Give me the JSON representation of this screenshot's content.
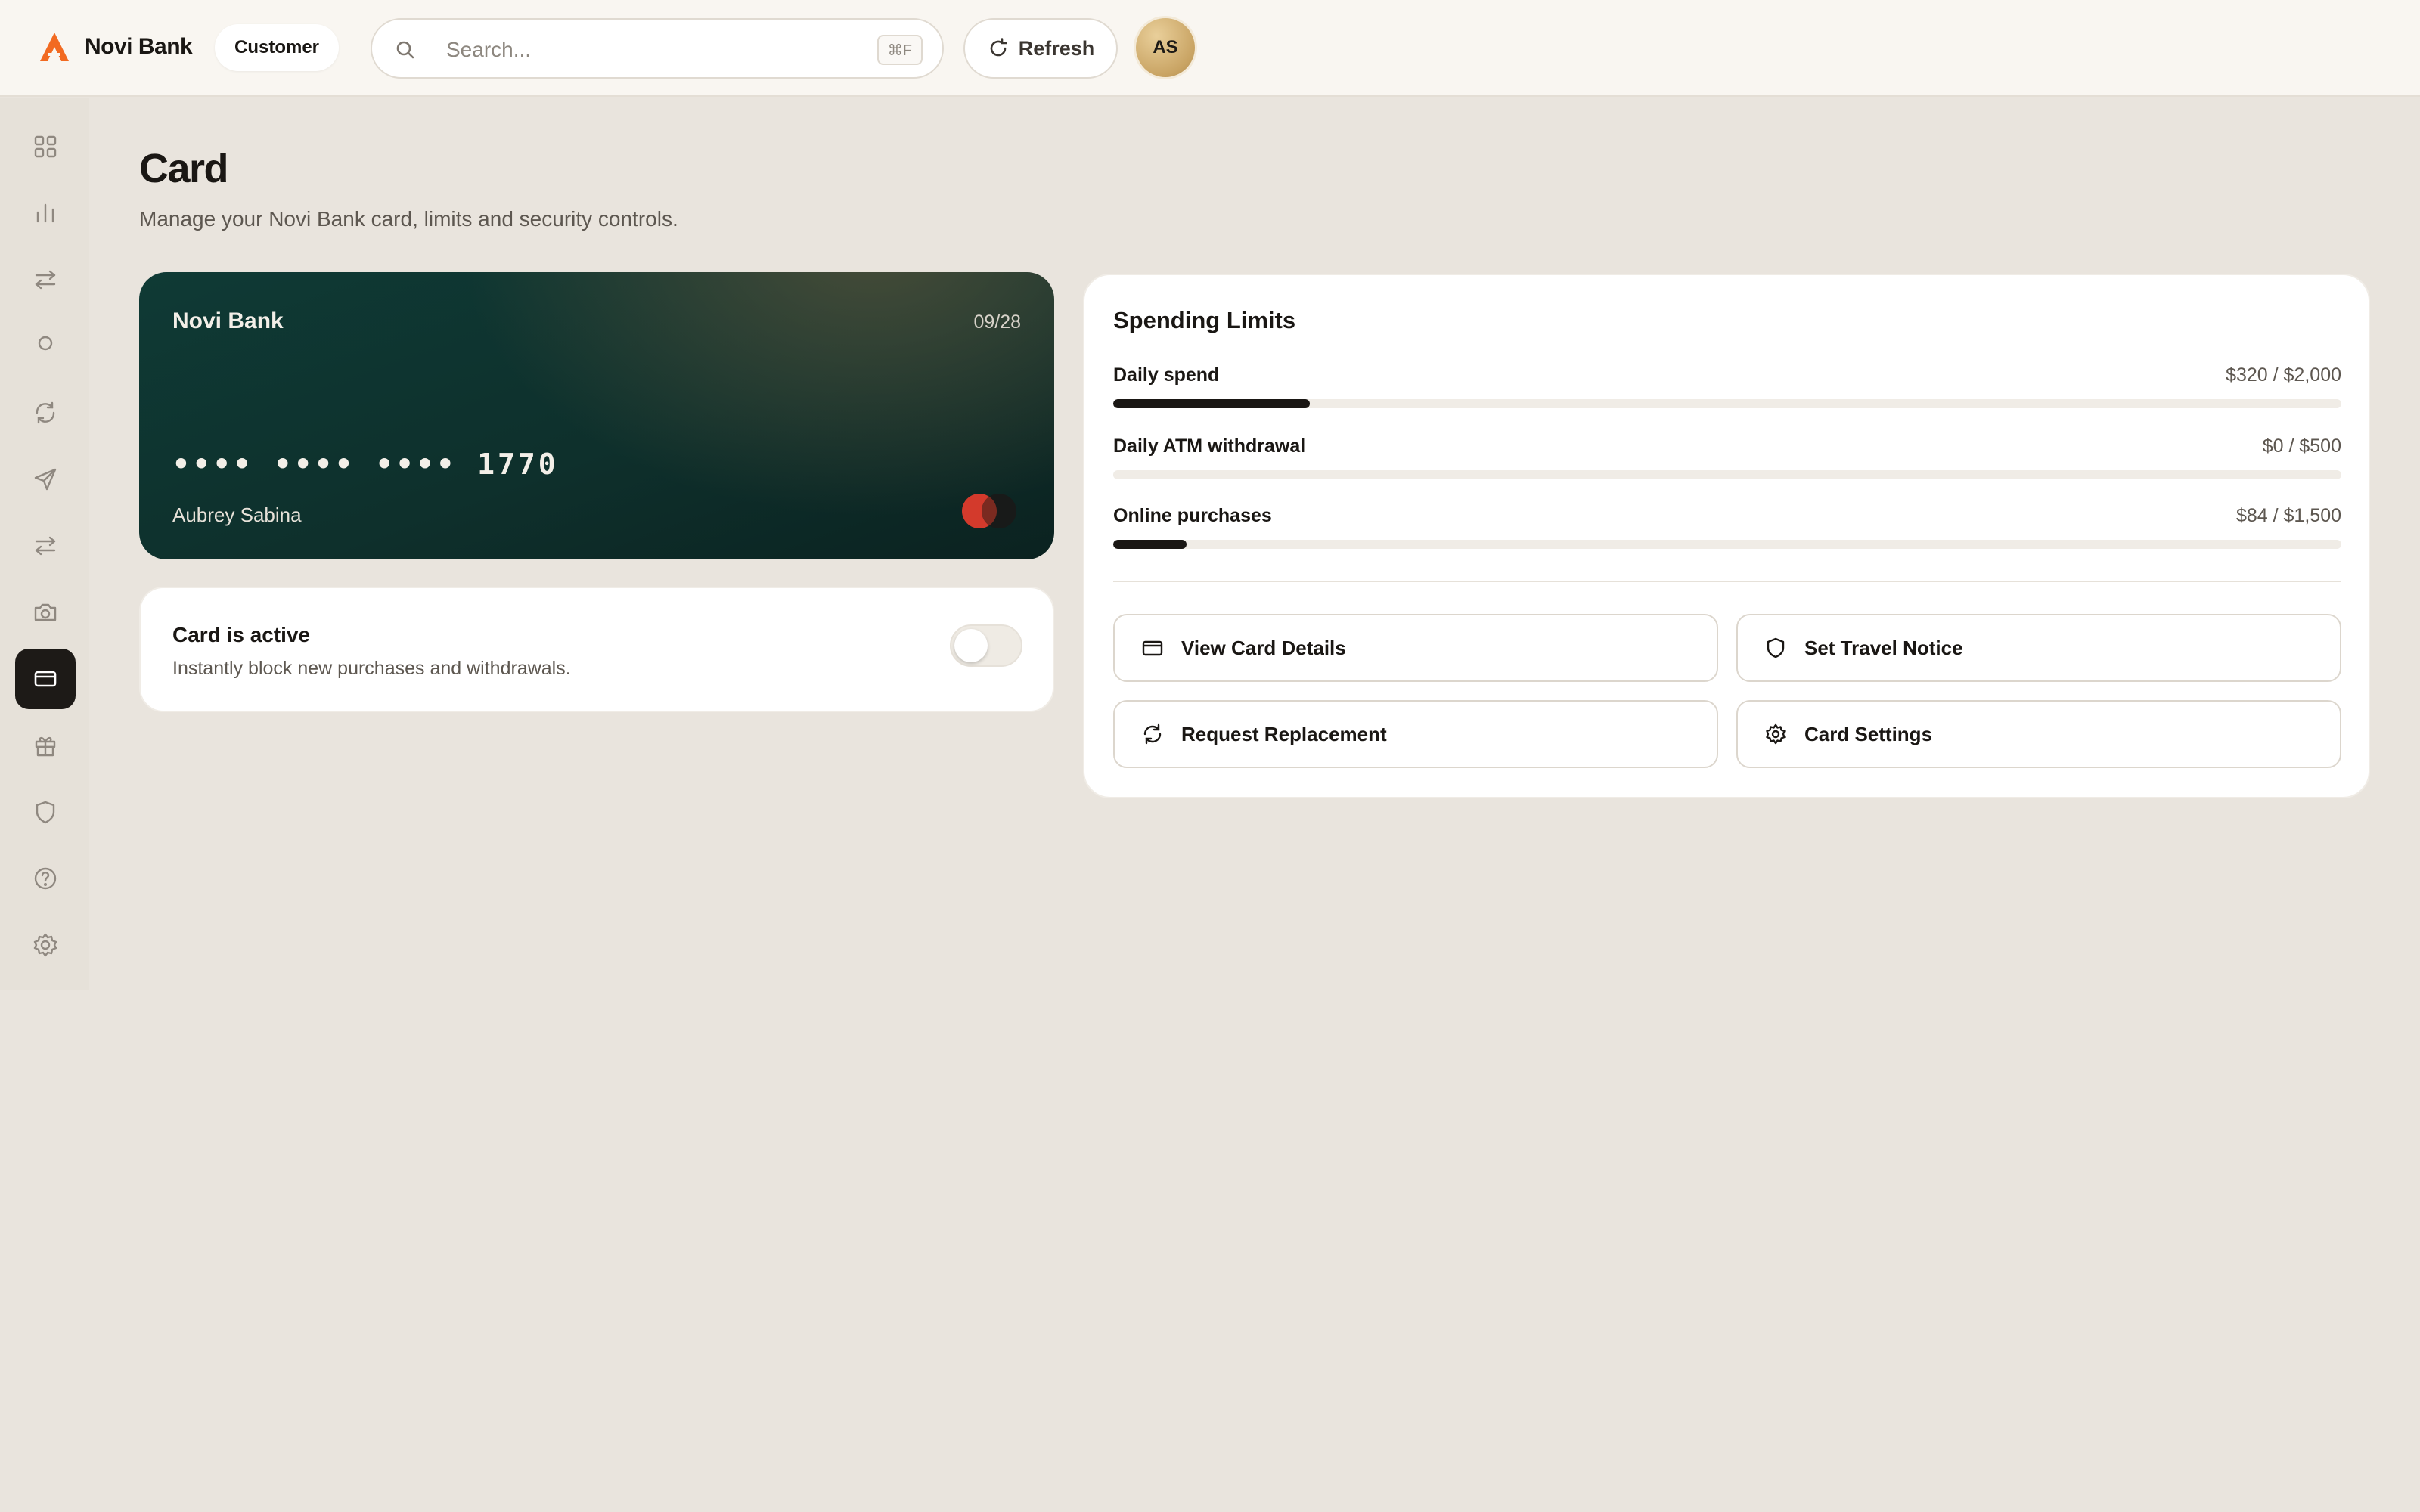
{
  "header": {
    "brand_name": "Novi Bank",
    "role": "Customer",
    "search_placeholder": "Search...",
    "search_shortcut": "⌘F",
    "refresh_label": "Refresh",
    "avatar_initials": "AS"
  },
  "sidebar": {
    "items": [
      {
        "icon": "grid-icon",
        "active": false
      },
      {
        "icon": "bar-chart-icon",
        "active": false
      },
      {
        "icon": "transfer-icon",
        "active": false
      },
      {
        "icon": "circle-icon",
        "active": false
      },
      {
        "icon": "refresh-icon",
        "active": false
      },
      {
        "icon": "send-icon",
        "active": false
      },
      {
        "icon": "exchange-icon",
        "active": false
      },
      {
        "icon": "camera-icon",
        "active": false
      },
      {
        "icon": "credit-card-icon",
        "active": true
      },
      {
        "icon": "gift-icon",
        "active": false
      },
      {
        "icon": "shield-icon",
        "active": false
      },
      {
        "icon": "help-icon",
        "active": false
      },
      {
        "icon": "settings-icon",
        "active": false
      }
    ]
  },
  "page": {
    "title": "Card",
    "subtitle": "Manage your Novi Bank card, limits and security controls."
  },
  "card": {
    "bank_name": "Novi Bank",
    "expiry": "09/28",
    "number": "•••• •••• •••• 1770",
    "holder": "Aubrey Sabina"
  },
  "status": {
    "title": "Card is active",
    "subtitle": "Instantly block new purchases and withdrawals.",
    "toggle_on": false
  },
  "limits": {
    "title": "Spending Limits",
    "items": [
      {
        "label": "Daily spend",
        "value": "$320 / $2,000",
        "used_fraction": 0.16
      },
      {
        "label": "Daily ATM withdrawal",
        "value": "$0 / $500",
        "used_fraction": 0.0
      },
      {
        "label": "Online purchases",
        "value": "$84 / $1,500",
        "used_fraction": 0.06
      }
    ]
  },
  "actions": {
    "view_details": "View Card Details",
    "travel_notice": "Set Travel Notice",
    "replacement": "Request Replacement",
    "settings": "Card Settings"
  },
  "colors": {
    "accent": "#f26a21",
    "card_bg": "#0f3a35",
    "page_bg": "#e9e4dd",
    "active_nav": "#1d1a17"
  }
}
